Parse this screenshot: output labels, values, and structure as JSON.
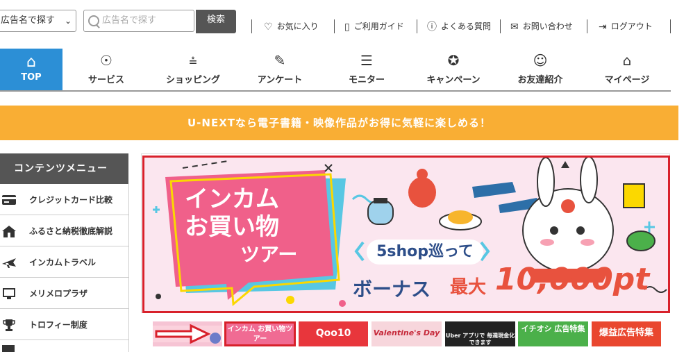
{
  "header": {
    "select_value": "広告名で探す",
    "search_placeholder": "広告名で探す",
    "search_button": "検索",
    "links": [
      {
        "label": "お気に入り",
        "icon": "heart-icon"
      },
      {
        "label": "ご利用ガイド",
        "icon": "guide-icon"
      },
      {
        "label": "よくある質問",
        "icon": "question-icon"
      },
      {
        "label": "お問い合わせ",
        "icon": "mail-icon"
      },
      {
        "label": "ログアウト",
        "icon": "logout-icon"
      }
    ]
  },
  "nav": {
    "top": "TOP",
    "items": [
      {
        "label": "サービス",
        "icon": "lightbulb-icon"
      },
      {
        "label": "ショッピング",
        "icon": "cart-icon"
      },
      {
        "label": "アンケート",
        "icon": "survey-icon"
      },
      {
        "label": "モニター",
        "icon": "monitor-icon"
      },
      {
        "label": "キャンペーン",
        "icon": "medal-icon"
      },
      {
        "label": "お友達紹介",
        "icon": "friends-icon"
      },
      {
        "label": "マイページ",
        "icon": "mypage-icon"
      }
    ]
  },
  "banner": {
    "text": "U-NEXTなら電子書籍・映像作品がお得に気軽に楽しめる！"
  },
  "sidebar": {
    "title": "コンテンツメニュー",
    "items": [
      {
        "label": "クレジットカード比較",
        "icon": "credit-card-icon"
      },
      {
        "label": "ふるさと納税徹底解説",
        "icon": "house-icon"
      },
      {
        "label": "インカムトラベル",
        "icon": "airplane-icon"
      },
      {
        "label": "メリメロプラザ",
        "icon": "monitor-icon"
      },
      {
        "label": "トロフィー制度",
        "icon": "trophy-icon"
      }
    ]
  },
  "hero": {
    "title_line1": "インカム",
    "title_line2": "お買い物",
    "title_line3": "ツアー",
    "shop_text": "5shop巡って",
    "bonus_label": "ボーナス",
    "max_label": "最大",
    "amount": "10,000pt"
  },
  "thumbnails": [
    {
      "label": "",
      "bg": "#f6c4d4"
    },
    {
      "label": "インカム お買い物ツアー",
      "bg": "#f06b93"
    },
    {
      "label": "Qoo10",
      "bg": "#e8363c"
    },
    {
      "label": "Valentine's Day",
      "bg": "#f7d6dc"
    },
    {
      "label": "Uber アプリで 毎週現金化できます",
      "bg": "#222222"
    },
    {
      "label": "イチオシ 広告特集",
      "bg": "#4bb04a"
    },
    {
      "label": "爆益広告特集",
      "bg": "#e9472f"
    }
  ],
  "colors": {
    "accent_blue": "#2c8fd6",
    "banner_orange": "#f9ae34",
    "highlight_red": "#d8212b"
  }
}
